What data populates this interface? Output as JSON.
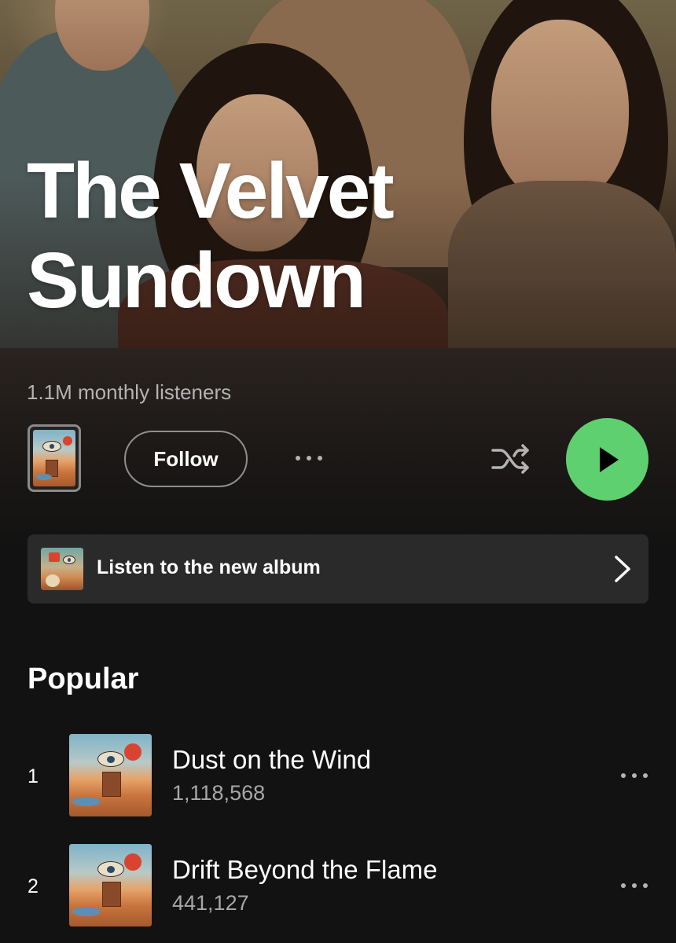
{
  "artist": {
    "name_line1": "The Velvet",
    "name_line2": "Sundown",
    "monthly_listeners": "1.1M monthly listeners"
  },
  "actions": {
    "follow_label": "Follow",
    "more_icon": "more-horizontal-icon",
    "shuffle_icon": "shuffle-icon",
    "play_icon": "play-icon"
  },
  "banner": {
    "label": "Listen to the new album",
    "chevron_icon": "chevron-right-icon"
  },
  "popular": {
    "title": "Popular",
    "tracks": [
      {
        "rank": "1",
        "title": "Dust on the Wind",
        "plays": "1,118,568"
      },
      {
        "rank": "2",
        "title": "Drift Beyond the Flame",
        "plays": "441,127"
      }
    ]
  },
  "colors": {
    "background": "#121212",
    "play_button": "#5fd06f",
    "banner_bg": "#2a2a2a",
    "secondary_text": "#b3b3b3"
  }
}
